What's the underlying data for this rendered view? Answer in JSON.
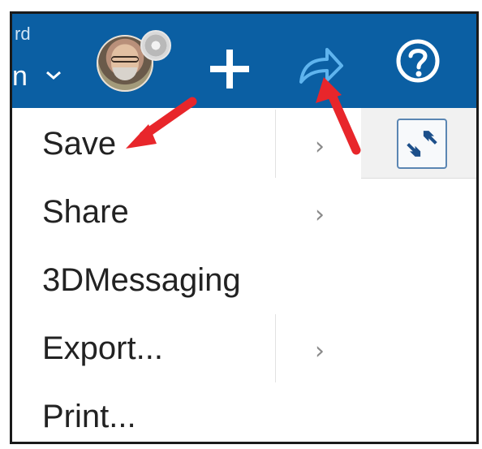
{
  "header": {
    "partial_text": "rd",
    "partial_name": "n",
    "add_icon": "plus-icon",
    "share_icon": "share-arrow-icon",
    "help_icon": "question-mark-icon"
  },
  "menu": {
    "items": [
      {
        "label": "Save",
        "has_submenu": true
      },
      {
        "label": "Share",
        "has_submenu": true
      },
      {
        "label": "3DMessaging",
        "has_submenu": false
      },
      {
        "label": "Export...",
        "has_submenu": true
      },
      {
        "label": "Print...",
        "has_submenu": false
      }
    ],
    "chevron": "›"
  },
  "colors": {
    "header_bg": "#0b5fa3",
    "share_icon": "#5fb4ee",
    "annotation_arrow": "#e8262b"
  }
}
